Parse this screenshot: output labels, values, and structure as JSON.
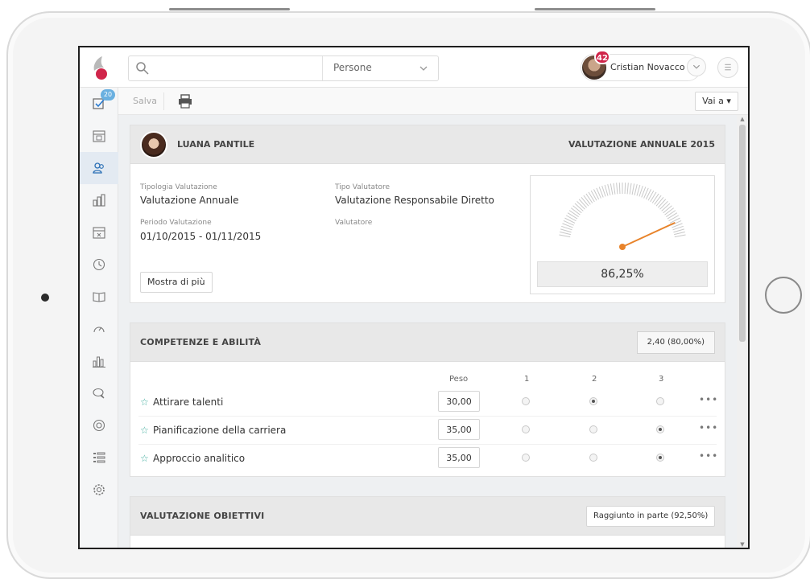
{
  "app": {
    "search_placeholder": "",
    "search_category": "Persone",
    "user_name": "Cristian Novacco",
    "notification_count": "42"
  },
  "sidebar": {
    "tasks_badge": "20",
    "items": [
      {
        "icon": "checklist-icon"
      },
      {
        "icon": "calendar-icon"
      },
      {
        "icon": "people-icon"
      },
      {
        "icon": "building-icon"
      },
      {
        "icon": "calendar-x-icon"
      },
      {
        "icon": "clock-icon"
      },
      {
        "icon": "book-icon"
      },
      {
        "icon": "speedometer-icon"
      },
      {
        "icon": "bar-chart-icon"
      },
      {
        "icon": "chat-icon"
      },
      {
        "icon": "lifebuoy-icon"
      },
      {
        "icon": "list-icon"
      },
      {
        "icon": "gear-icon"
      }
    ]
  },
  "toolbar": {
    "save_label": "Salva",
    "goto_label": "Vai a ▾"
  },
  "employee": {
    "name": "LUANA PANTILE",
    "review_title": "VALUTAZIONE ANNUALE 2015",
    "type_label": "Tipologia Valutazione",
    "type_value": "Valutazione Annuale",
    "evaluator_type_label": "Tipo Valutatore",
    "evaluator_type_value": "Valutazione Responsabile Diretto",
    "period_label": "Periodo Valutazione",
    "period_value": "01/10/2015 - 01/11/2015",
    "evaluator_label": "Valutatore",
    "more_button": "Mostra di più",
    "score": "86,25%",
    "gauge_fraction": 0.8625
  },
  "skills": {
    "title": "COMPETENZE E ABILITÀ",
    "score": "2,40 (80,00%)",
    "col_weight": "Peso",
    "col_1": "1",
    "col_2": "2",
    "col_3": "3",
    "rows": [
      {
        "name": "Attirare talenti",
        "weight": "30,00",
        "selected": 2
      },
      {
        "name": "Pianificazione della carriera",
        "weight": "35,00",
        "selected": 3
      },
      {
        "name": "Approccio analitico",
        "weight": "35,00",
        "selected": 3
      }
    ],
    "star_glyph": "☆",
    "more_glyph": "•••"
  },
  "objectives": {
    "title": "VALUTAZIONE OBIETTIVI",
    "status": "Raggiunto in parte (92,50%)"
  },
  "colors": {
    "accent_red": "#d0254a",
    "gauge_needle": "#e8832a",
    "star": "#3dab9c"
  }
}
